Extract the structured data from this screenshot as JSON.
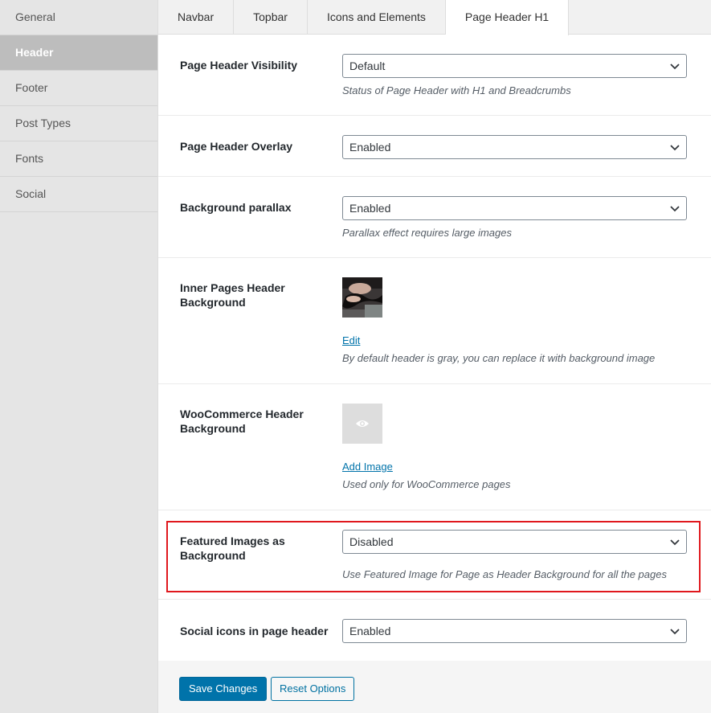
{
  "sidebar": {
    "items": [
      {
        "label": "General"
      },
      {
        "label": "Header"
      },
      {
        "label": "Footer"
      },
      {
        "label": "Post Types"
      },
      {
        "label": "Fonts"
      },
      {
        "label": "Social"
      }
    ],
    "active_index": 1
  },
  "tabs": [
    {
      "label": "Navbar"
    },
    {
      "label": "Topbar"
    },
    {
      "label": "Icons and Elements"
    },
    {
      "label": "Page Header H1"
    }
  ],
  "active_tab": 3,
  "settings": {
    "visibility": {
      "label": "Page Header Visibility",
      "value": "Default",
      "description": "Status of Page Header with H1 and Breadcrumbs"
    },
    "overlay": {
      "label": "Page Header Overlay",
      "value": "Enabled"
    },
    "parallax": {
      "label": "Background parallax",
      "value": "Enabled",
      "description": "Parallax effect requires large images"
    },
    "inner_bg": {
      "label": "Inner Pages Header Background",
      "link": "Edit",
      "description": "By default header is gray, you can replace it with background image"
    },
    "woo_bg": {
      "label": "WooCommerce Header Background",
      "link": "Add Image",
      "description": "Used only for WooCommerce pages"
    },
    "featured": {
      "label": "Featured Images as Background",
      "value": "Disabled",
      "description": "Use Featured Image for Page as Header Background for all the pages"
    },
    "social_icons": {
      "label": "Social icons in page header",
      "value": "Enabled"
    }
  },
  "buttons": {
    "save": "Save Changes",
    "reset": "Reset Options"
  },
  "colors": {
    "accent": "#0073aa",
    "highlight_border": "#e0181d",
    "sidebar_active": "#bdbdbd"
  },
  "icons": {
    "select_arrow": "chevron-down-icon",
    "placeholder": "eye-icon"
  }
}
